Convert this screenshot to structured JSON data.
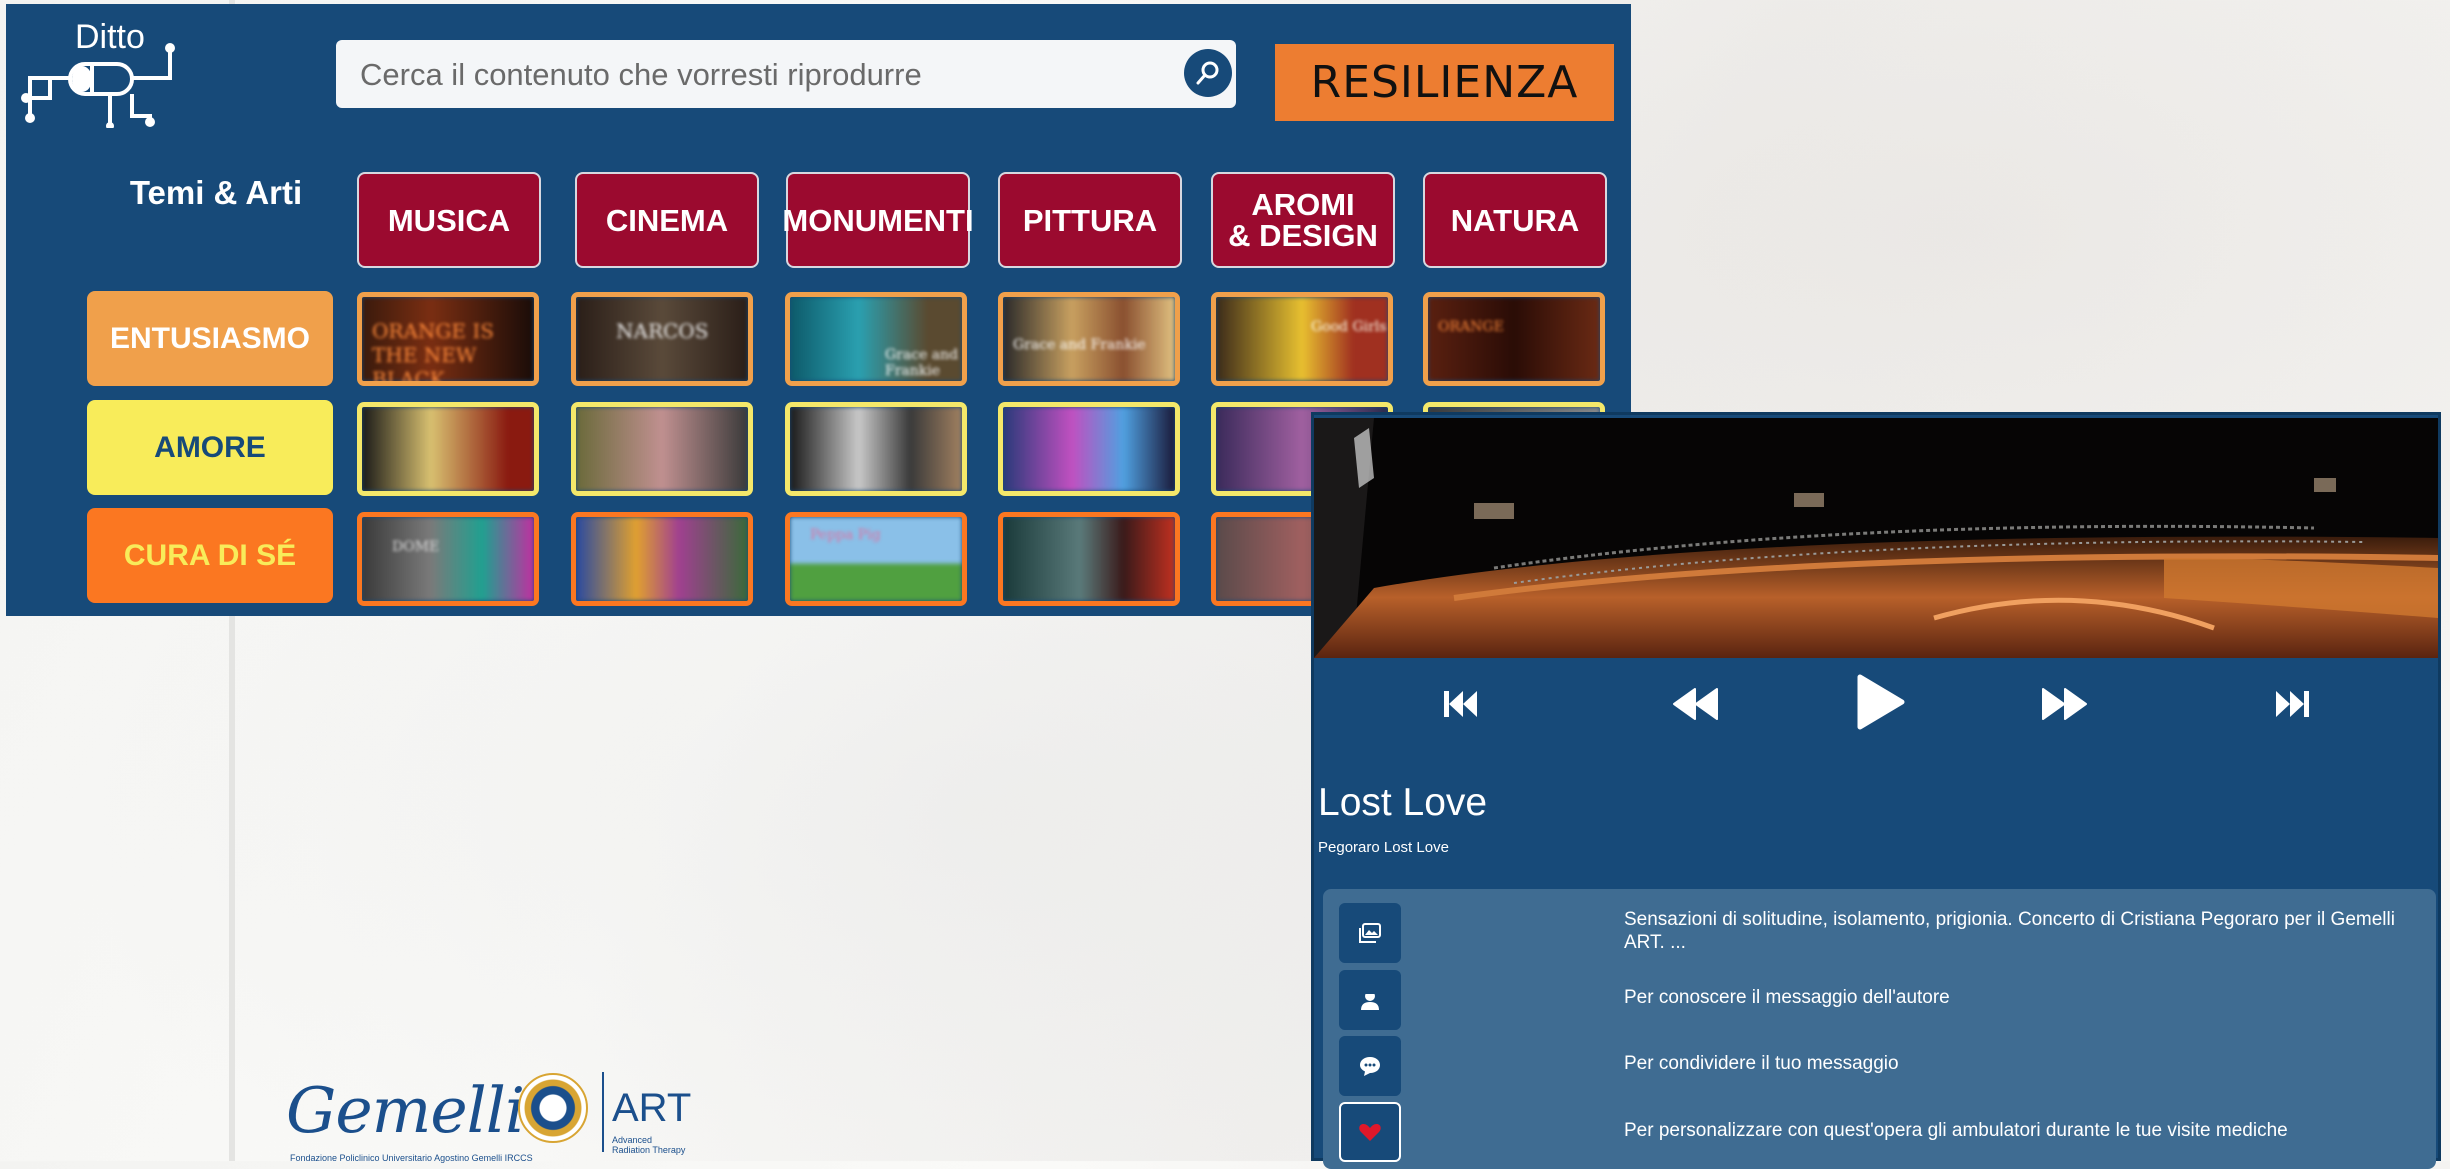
{
  "app": {
    "name": "Ditto"
  },
  "search": {
    "placeholder": "Cerca il contenuto che vorresti riprodurre"
  },
  "theme_button": {
    "label": "RESILIENZA",
    "color": "#ed7d31"
  },
  "grid": {
    "header_label": "Temi & Arti",
    "categories": [
      "MUSICA",
      "CINEMA",
      "MONUMENTI",
      "PITTURA",
      "AROMI\n& DESIGN",
      "NATURA"
    ],
    "moods": [
      {
        "label": "ENTUSIASMO",
        "bg": "#f0a04b",
        "fg": "#ffffff",
        "border": "#f0a04b"
      },
      {
        "label": "AMORE",
        "bg": "#f8ec5a",
        "fg": "#174a79",
        "border": "#f4e86a"
      },
      {
        "label": "CURA DI SÉ",
        "bg": "#fb7721",
        "fg": "#f8ec5a",
        "border": "#fb7721"
      }
    ],
    "thumbnails": [
      [
        "ORANGE IS THE NEW BLACK",
        "NARCOS",
        "Grace and Frankie",
        "Grace and Frankie",
        "Good Girls",
        "ORANGE"
      ],
      [
        "",
        "",
        "",
        "",
        "",
        ""
      ],
      [
        "DOME",
        "",
        "Peppa Pig",
        "",
        "",
        ""
      ]
    ]
  },
  "player": {
    "title": "Lost Love",
    "subtitle": "Pegoraro Lost Love",
    "controls": [
      "skip-start",
      "rewind",
      "play",
      "fast-forward",
      "skip-end"
    ],
    "info_items": [
      {
        "icon": "gallery-icon",
        "text": "Sensazioni di solitudine, isolamento, prigionia. Concerto di Cristiana Pegoraro per il Gemelli ART. ..."
      },
      {
        "icon": "author-icon",
        "text": "Per conoscere il messaggio dell'autore"
      },
      {
        "icon": "chat-icon",
        "text": "Per condividere il tuo messaggio"
      },
      {
        "icon": "heart-icon",
        "text": "Per personalizzare con quest'opera gli ambulatori durante le tue visite mediche"
      }
    ]
  },
  "footer": {
    "brand": "Gemelli",
    "art": "ART",
    "art_sub": "Advanced Radiation Therapy",
    "tagline": "Fondazione Policlinico Universitario Agostino Gemelli IRCCS"
  },
  "colors": {
    "panel": "#174a79",
    "category": "#9b0a2f",
    "info_box": "#3f6c92"
  }
}
